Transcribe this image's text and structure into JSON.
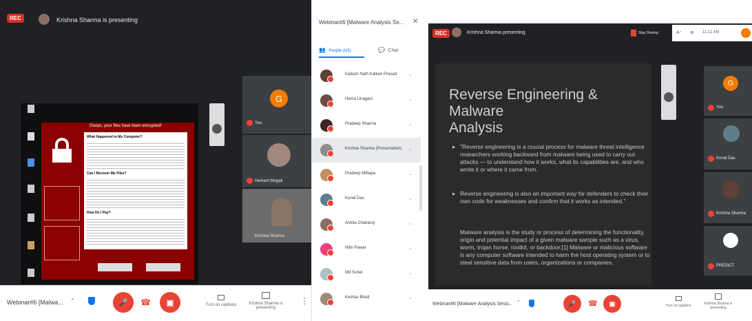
{
  "left": {
    "rec": "REC",
    "presenter": "Krishna Sharma is presenting",
    "ransom_title": "Ooops, your files have been encrypted!",
    "ransom_q1": "What Happened to My Computer?",
    "ransom_q2": "Can I Recover My Files?",
    "ransom_q3": "How Do I Pay?",
    "tiles": [
      {
        "name": "You",
        "initial": "G"
      },
      {
        "name": "Hemant Mogali"
      },
      {
        "name": "Krishna Sharma"
      }
    ],
    "meeting": "Webinar#6 [Malwa...",
    "captions_label": "Turn on captions",
    "present_label": "Krishna Sharma is presenting"
  },
  "panel": {
    "title": "Webinar#6 [Malware Analysis Se...",
    "tab_people": "People (Ix5)",
    "tab_chat": "Chat",
    "people": [
      {
        "name": "Kailash Nath Katkeri Prasad",
        "color": "#5d4037"
      },
      {
        "name": "Hema Unagani",
        "color": "#6d4c41"
      },
      {
        "name": "Pradeep Sharma",
        "color": "#3e2723"
      },
      {
        "name": "Krishna Sharma (Presentation)",
        "color": "#8d8d8d"
      },
      {
        "name": "Pradeep Mittapa",
        "color": "#c09060"
      },
      {
        "name": "Kunal Das",
        "color": "#607d8b"
      },
      {
        "name": "Ankita Chakarvy",
        "color": "#8d6e63"
      },
      {
        "name": "Nitin Pawar",
        "color": "#ec407a"
      },
      {
        "name": "Md Suhel",
        "color": "#b0bec5"
      },
      {
        "name": "Keshav Bhatt",
        "color": "#a1887f"
      }
    ]
  },
  "right": {
    "rec": "REC",
    "presenter": "Krishna Sharma presenting",
    "time": "11:11 AM",
    "stop_label": "Stop Sharing",
    "slide_title_1": "Reverse Engineering & Malware",
    "slide_title_2": "Analysis",
    "bullets": [
      "\"Reverse engineering is a crucial process for malware threat intelligence researchers working backward from malware being used to carry out attacks — to understand how it works, what its capabilities are, and who wrote it or where it came from.",
      "Reverse engineering is also an important way for defenders to check their own code for weaknesses and confirm that it works as intended.\"",
      "Malware analysis is the study or process of determining the functionality, origin and potential impact of a given malware sample such as a virus, worm, trojan horse, rootkit, or backdoor.[1] Malware or malicious software is any computer software intended to harm the host operating system or to steal sensitive data from users, organizations or companies."
    ],
    "tiles": [
      {
        "name": "You",
        "initial": "G"
      },
      {
        "name": "Kunal Das"
      },
      {
        "name": "Krishna Sharma"
      },
      {
        "name": "PREDICT"
      }
    ],
    "meeting": "Webinar#6 [Malware Analysis Sessi...",
    "captions_label": "Turn on captions",
    "present_label": "Krishna Sharma is presenting"
  }
}
